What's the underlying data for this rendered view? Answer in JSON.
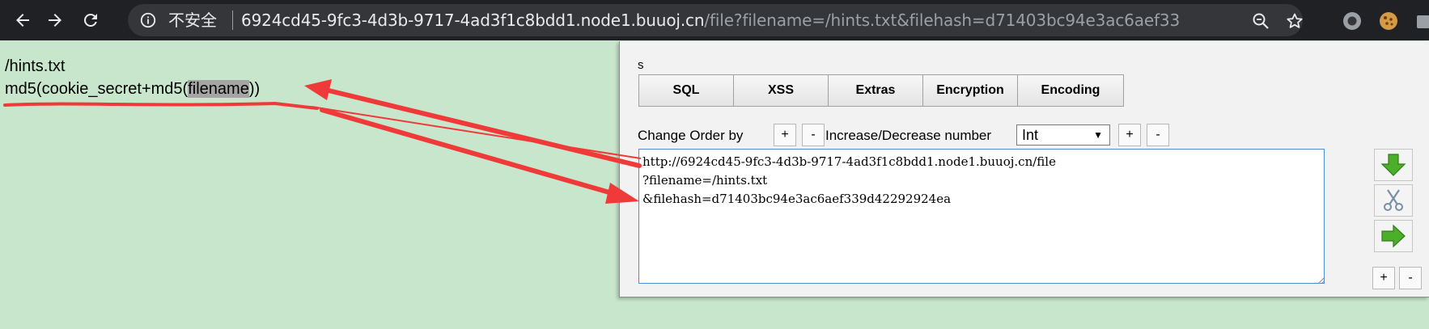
{
  "browser": {
    "security_label": "不安全",
    "url_host": "6924cd45-9fc3-4d3b-9717-4ad3f1c8bdd1.node1.buuoj.cn",
    "url_path": "/file?filename=/hints.txt&filehash=d71403bc94e3ac6aef339d4..."
  },
  "page": {
    "line1": "/hints.txt",
    "line2_before": "md5(cookie_secret+md5(",
    "line2_highlight": "filename",
    "line2_after": "))"
  },
  "hackbar": {
    "label": "s",
    "tabs": [
      "SQL",
      "XSS",
      "Extras",
      "Encryption",
      "Encoding"
    ],
    "change_order_label": "Change Order by",
    "increase_decrease_label": "Increase/Decrease number",
    "plus": "+",
    "minus": "-",
    "number_type": "Int",
    "textarea_value": "http://6924cd45-9fc3-4d3b-9717-4ad3f1c8bdd1.node1.buuoj.cn/file\n?filename=/hints.txt\n&filehash=d71403bc94e3ac6aef339d42292924ea"
  },
  "colors": {
    "page_background": "#c8e6cc",
    "toolbar": "#202124",
    "annotation_red": "#f03a3a",
    "textarea_border": "#4d8fd6"
  },
  "icons": [
    "back-arrow-icon",
    "forward-arrow-icon",
    "reload-icon",
    "info-icon",
    "zoom-icon",
    "star-icon",
    "circle-extension-icon",
    "cookie-extension-icon",
    "green-down-arrow-icon",
    "scissors-icon",
    "green-right-arrow-icon"
  ]
}
